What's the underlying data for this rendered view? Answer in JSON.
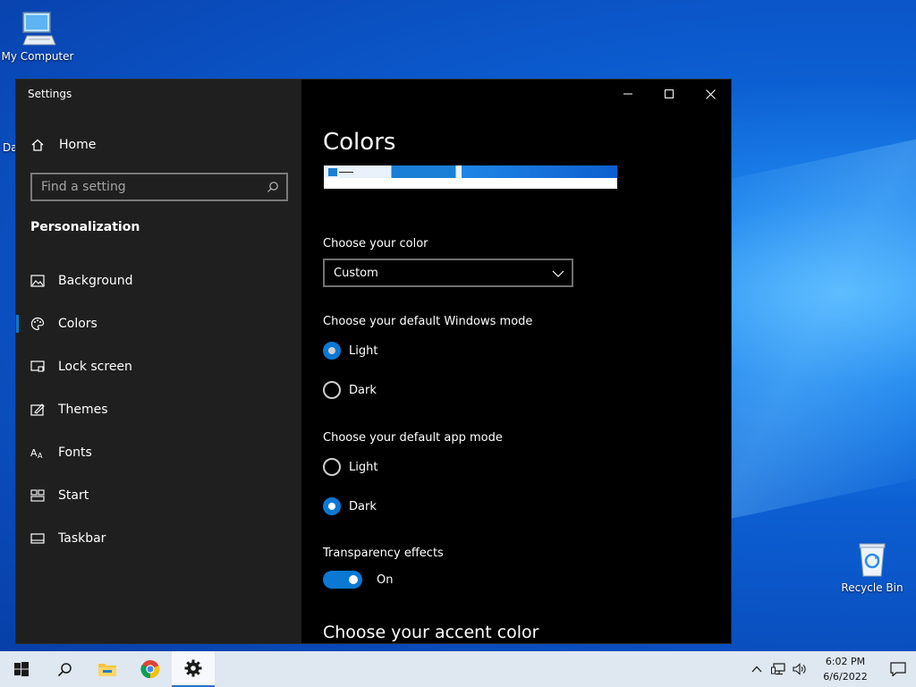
{
  "desktop": {
    "icons": [
      {
        "label": "My Computer"
      },
      {
        "label": "Recycle Bin"
      }
    ],
    "partial_label": "Da"
  },
  "window": {
    "app_title": "Settings",
    "sidebar": {
      "home_label": "Home",
      "search_placeholder": "Find a setting",
      "section_heading": "Personalization",
      "items": [
        {
          "label": "Background",
          "icon": "picture-icon"
        },
        {
          "label": "Colors",
          "icon": "palette-icon",
          "active": true
        },
        {
          "label": "Lock screen",
          "icon": "lock-screen-icon"
        },
        {
          "label": "Themes",
          "icon": "themes-icon"
        },
        {
          "label": "Fonts",
          "icon": "fonts-icon"
        },
        {
          "label": "Start",
          "icon": "start-icon"
        },
        {
          "label": "Taskbar",
          "icon": "taskbar-icon"
        }
      ]
    },
    "content": {
      "title": "Colors",
      "choose_color_label": "Choose your color",
      "choose_color_value": "Custom",
      "windows_mode_label": "Choose your default Windows mode",
      "windows_mode_options": [
        {
          "label": "Light",
          "checked": true
        },
        {
          "label": "Dark",
          "checked": false
        }
      ],
      "app_mode_label": "Choose your default app mode",
      "app_mode_options": [
        {
          "label": "Light",
          "checked": false
        },
        {
          "label": "Dark",
          "checked": true
        }
      ],
      "transparency_label": "Transparency effects",
      "transparency_state": "On",
      "accent_heading": "Choose your accent color"
    }
  },
  "taskbar": {
    "time": "6:02 PM",
    "date": "6/6/2022"
  },
  "colors": {
    "accent": "#0a78d4",
    "sidebar_bg": "#1f1f1f",
    "content_bg": "#000000",
    "taskbar_bg": "#dfe7f0"
  }
}
